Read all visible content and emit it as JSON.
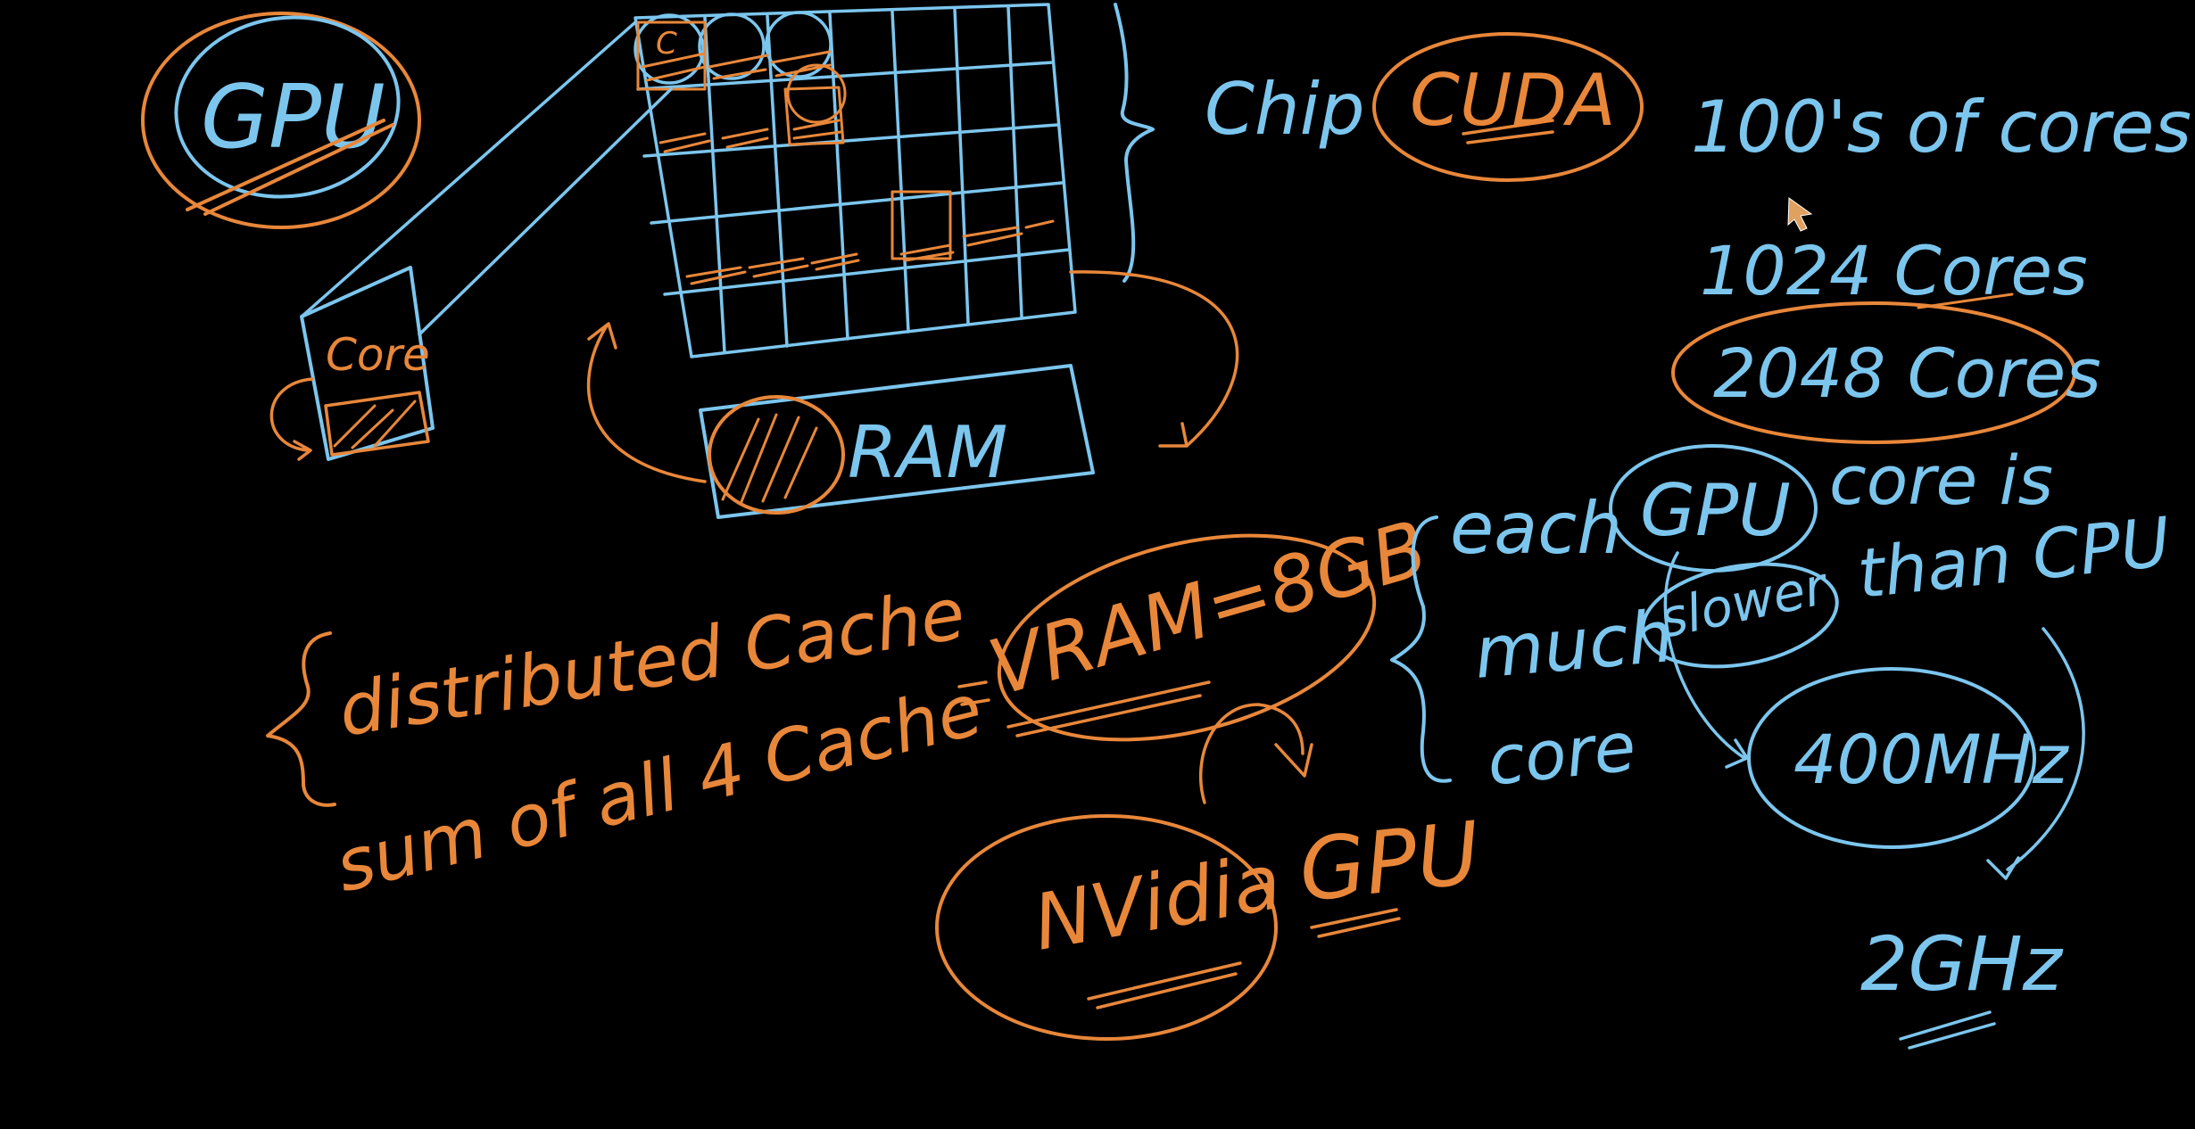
{
  "colors": {
    "background": "#000000",
    "orange": "#e8873a",
    "blue": "#7cc6ee",
    "cursor": "#e0a060"
  },
  "diagram": {
    "gpu_label": "GPU",
    "cuda_label": "CUDA",
    "chip_label": "Chip",
    "core_box_label": "Core",
    "grid_core_label": "C",
    "vram_box_label": "RAM",
    "vram_eq_label": "VRAM=8GB",
    "cores_list": {
      "line1": "100's of cores",
      "line2": "1024 Cores",
      "line3": "2048 Cores"
    },
    "cache_notes": {
      "line1": "distributed Cache",
      "line2": "sum of all 4 Cache"
    },
    "nvidia_label": "NVidia",
    "nvidia_gpu_label": "GPU",
    "core_speed_note": {
      "word_each": "each",
      "word_gpu": "GPU",
      "word_core_is": "core is",
      "word_much": "much",
      "word_slower": "slower",
      "word_than_cpu": "than CPU",
      "word_core": "core"
    },
    "freq_gpu": "400MHz",
    "freq_cpu": "2GHz"
  }
}
